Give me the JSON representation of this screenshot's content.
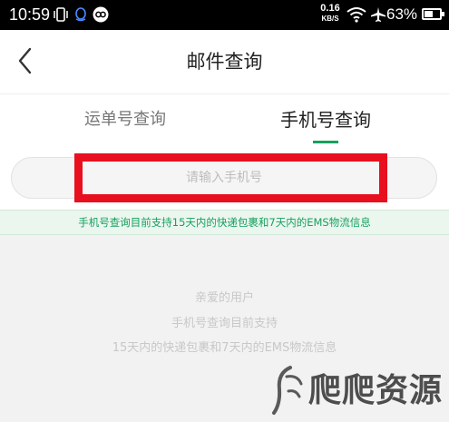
{
  "status_bar": {
    "time": "10:59",
    "net_speed_value": "0.16",
    "net_speed_unit": "KB/S",
    "battery_percent": "63%",
    "battery_level": 0.63,
    "icons": [
      "vibrate-icon",
      "qq-icon",
      "link-icon",
      "wifi-icon",
      "airplane-icon",
      "battery-icon"
    ]
  },
  "header": {
    "title": "邮件查询",
    "back_icon": "chevron-left-icon"
  },
  "tabs": [
    {
      "label": "运单号查询",
      "active": false
    },
    {
      "label": "手机号查询",
      "active": true
    }
  ],
  "search": {
    "placeholder": "请输入手机号",
    "value": ""
  },
  "notice": "手机号查询目前支持15天内的快递包裹和7天内的EMS物流信息",
  "info": {
    "lines": [
      "亲爱的用户",
      "手机号查询目前支持",
      "15天内的快递包裹和7天内的EMS物流信息"
    ]
  },
  "watermark": {
    "text": "爬爬资源"
  },
  "colors": {
    "accent": "#16a05d",
    "highlight": "#e8101e",
    "status_bar": "#000000",
    "info_background": "#f2f2f2"
  }
}
